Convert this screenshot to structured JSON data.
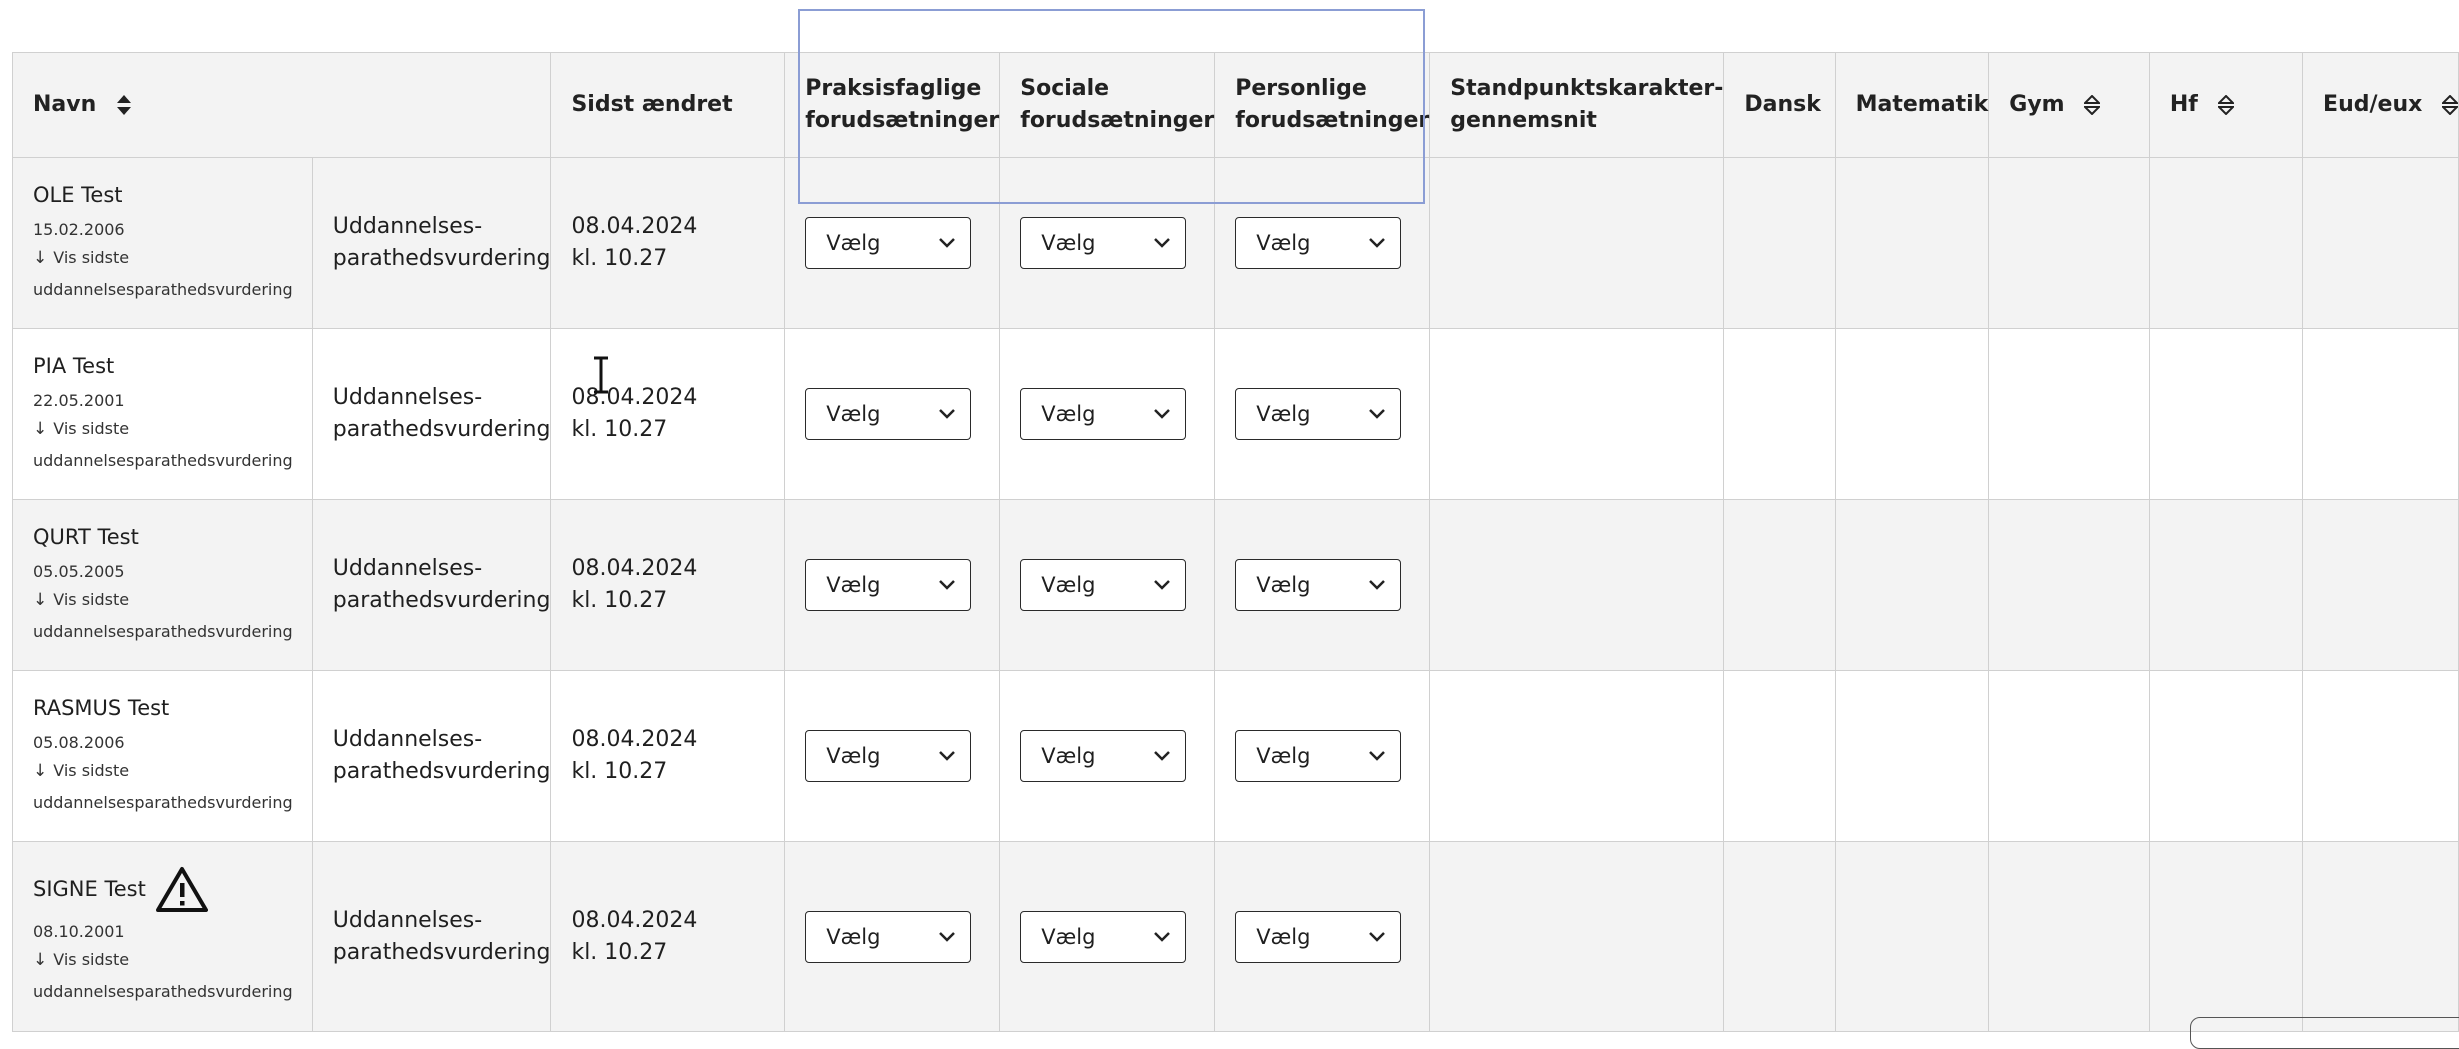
{
  "columns": {
    "navn": "Navn",
    "sidst_aendret": "Sidst ændret",
    "praksisfaglige_1": "Praksisfaglige",
    "praksisfaglige_2": "forudsætninger",
    "sociale_1": "Sociale",
    "sociale_2": "forudsætninger",
    "personlige_1": "Personlige",
    "personlige_2": "forudsætninger",
    "standpunkt_1": "Standpunktskarakter-",
    "standpunkt_2": "gennemsnit",
    "dansk": "Dansk",
    "matematik": "Matematik",
    "gym": "Gym",
    "hf": "Hf",
    "eud": "Eud/eux"
  },
  "rows": [
    {
      "name": "OLE Test",
      "dob": "15.02.2006",
      "vis_label": "Vis sidste",
      "vis_label_2": "uddannelsesparathedsvurdering",
      "type_1": "Uddannelses-",
      "type_2": "parathedsvurdering",
      "date": "08.04.2024",
      "time": "kl. 10.27",
      "prak": "Vælg",
      "soc": "Vælg",
      "pers": "Vælg",
      "warning": false
    },
    {
      "name": "PIA Test",
      "dob": "22.05.2001",
      "vis_label": "Vis sidste",
      "vis_label_2": "uddannelsesparathedsvurdering",
      "type_1": "Uddannelses-",
      "type_2": "parathedsvurdering",
      "date": "08.04.2024",
      "time": "kl. 10.27",
      "prak": "Vælg",
      "soc": "Vælg",
      "pers": "Vælg",
      "warning": false
    },
    {
      "name": "QURT Test",
      "dob": "05.05.2005",
      "vis_label": "Vis sidste",
      "vis_label_2": "uddannelsesparathedsvurdering",
      "type_1": "Uddannelses-",
      "type_2": "parathedsvurdering",
      "date": "08.04.2024",
      "time": "kl. 10.27",
      "prak": "Vælg",
      "soc": "Vælg",
      "pers": "Vælg",
      "warning": false
    },
    {
      "name": "RASMUS Test",
      "dob": "05.08.2006",
      "vis_label": "Vis sidste",
      "vis_label_2": "uddannelsesparathedsvurdering",
      "type_1": "Uddannelses-",
      "type_2": "parathedsvurdering",
      "date": "08.04.2024",
      "time": "kl. 10.27",
      "prak": "Vælg",
      "soc": "Vælg",
      "pers": "Vælg",
      "warning": false
    },
    {
      "name": "SIGNE Test",
      "dob": "08.10.2001",
      "vis_label": "Vis sidste",
      "vis_label_2": "uddannelsesparathedsvurdering",
      "type_1": "Uddannelses-",
      "type_2": "parathedsvurdering",
      "date": "08.04.2024",
      "time": "kl. 10.27",
      "prak": "Vælg",
      "soc": "Vælg",
      "pers": "Vælg",
      "warning": true
    }
  ],
  "icons": {
    "sort": "sort-icon",
    "dropdown": "chevron-down-icon",
    "warning": "warning-icon",
    "arrow": "arrow-down-icon"
  },
  "colors": {
    "header_bg": "#f3f3f3",
    "row_shaded": "#f3f3f3",
    "row_plain": "#ffffff",
    "focus_box": "#8b9dd4",
    "border": "#d0d0d0"
  }
}
